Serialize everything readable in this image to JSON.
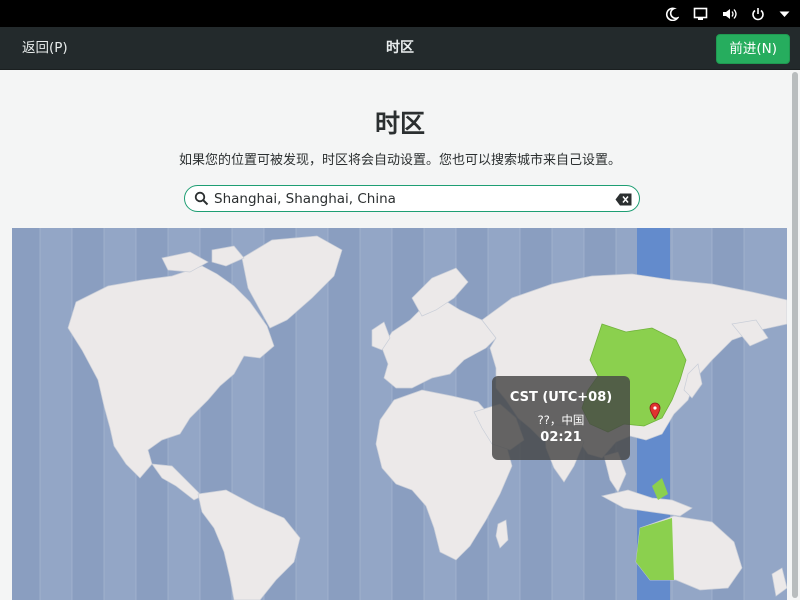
{
  "system_tray": {
    "icons": [
      "moon-icon",
      "screen-icon",
      "volume-icon",
      "power-icon",
      "menu-arrow-icon"
    ]
  },
  "header": {
    "back_label": "返回(P)",
    "title": "时区",
    "next_label": "前进(N)"
  },
  "main": {
    "title": "时区",
    "description": "如果您的位置可被发现，时区将会自动设置。您也可以搜索城市来自己设置。",
    "search": {
      "value": "Shanghai, Shanghai, China",
      "icon": "search-icon",
      "clear_icon": "clear-icon"
    }
  },
  "map": {
    "tooltip": {
      "zone": "CST (UTC+08)",
      "location": "??，中国",
      "time": "02:21"
    }
  },
  "colors": {
    "accent": "#26ad5e",
    "ocean": "#93a6c6",
    "land": "#ece9e9",
    "selected_zone": "#5e88cc",
    "selected_country": "#8bd04e"
  }
}
